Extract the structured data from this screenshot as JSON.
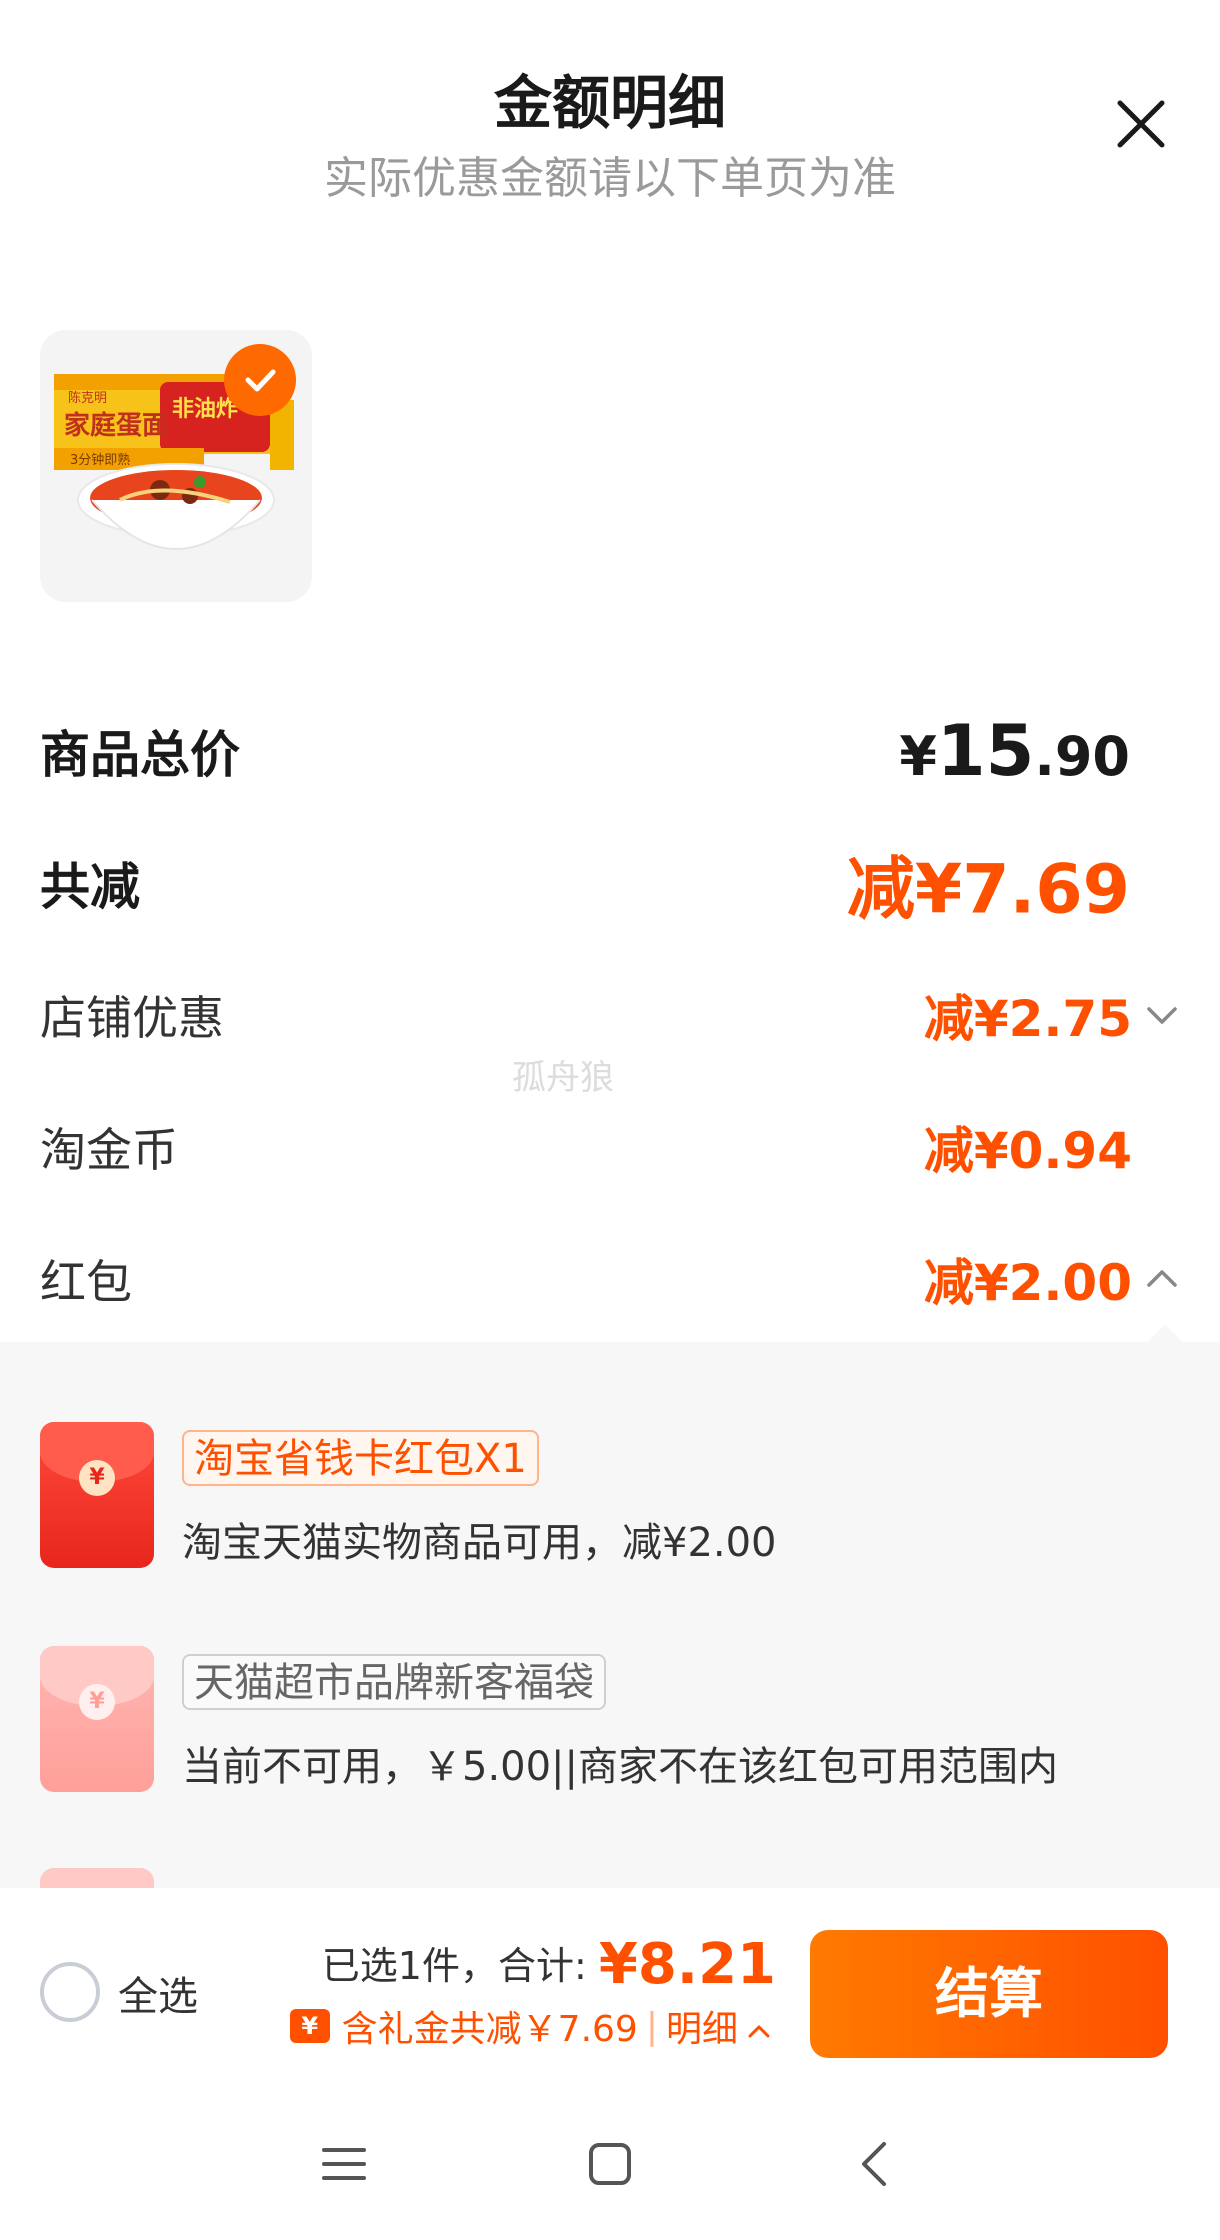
{
  "header": {
    "title": "金额明细",
    "subtitle": "实际优惠金额请以下单页为准"
  },
  "product": {
    "brand": "陈克明",
    "name": "家庭蛋面",
    "badge": "非油炸",
    "note": "3分钟即熟",
    "selected": true
  },
  "summary": {
    "total_label": "商品总价",
    "total_currency": "¥",
    "total_int": "15",
    "total_dec": ".90",
    "reduce_label": "共减",
    "reduce_value": "减¥7.69",
    "items": [
      {
        "label": "店铺优惠",
        "value": "减¥2.75"
      },
      {
        "label": "淘金币",
        "value": "减¥0.94"
      },
      {
        "label": "红包",
        "value": "减¥2.00"
      }
    ]
  },
  "redpackets": [
    {
      "tag": "淘宝省钱卡红包X1",
      "desc": "淘宝天猫实物商品可用，减¥2.00",
      "available": true
    },
    {
      "tag": "天猫超市品牌新客福袋",
      "desc": "当前不可用，￥5.00||商家不在该红包可用范围内",
      "available": false
    }
  ],
  "footer": {
    "select_all": "全选",
    "selected_text": "已选1件，合计:",
    "total": "¥8.21",
    "gift_text": "含礼金共减￥7.69",
    "detail_link": "明细",
    "checkout": "结算"
  },
  "watermark": "孤舟狼",
  "colors": {
    "accent": "#ff5000",
    "accent_light": "#ff7a00",
    "panel_bg": "#f7f7f7"
  }
}
